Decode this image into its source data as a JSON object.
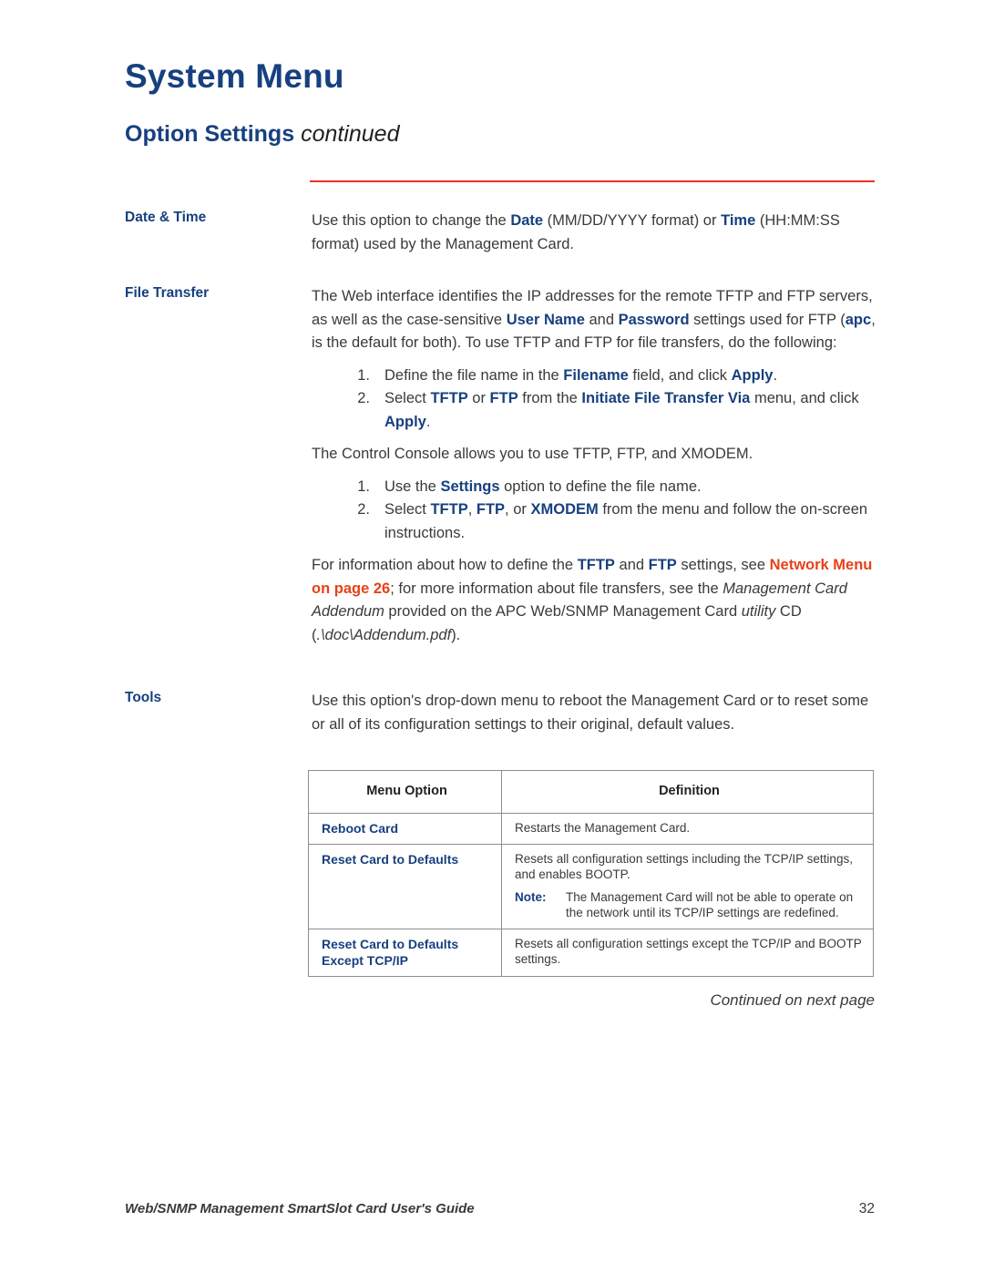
{
  "header": {
    "chapter_title": "System Menu",
    "section_title": "Option Settings",
    "section_continued": "continued"
  },
  "sections": [
    {
      "label": "Date & Time",
      "paragraphs": [
        "Use this option to change the Date (MM/DD/YYYY format) or Time (HH:MM:SS format) used by the Management Card."
      ]
    },
    {
      "label": "File Transfer",
      "intro": "The Web interface identifies the IP addresses for the remote TFTP and FTP servers, as well as the case-sensitive User Name and Password settings used for FTP (apc, is the default for both). To use TFTP and FTP for file transfers, do the following:",
      "list_web": [
        "Define the file name in the Filename field, and click Apply.",
        "Select TFTP or FTP from the Initiate File Transfer Via menu, and click Apply."
      ],
      "console_intro": "The Control Console allows you to use TFTP, FTP, and XMODEM.",
      "list_console": [
        "Use the Settings option to define the file name.",
        "Select TFTP, FTP, or XMODEM from the menu and follow the on-screen instructions."
      ],
      "outro": "For information about how to define the TFTP and FTP settings, see Network Menu on page 26; for more information about file transfers, see the Management Card Addendum provided on the APC Web/SNMP Management Card utility CD (.\\doc\\Addendum.pdf).",
      "xref": "Network Menu on page 26"
    },
    {
      "label": "Tools",
      "paragraphs": [
        "Use this option's drop-down menu to reboot the Management Card or to reset some or all of its configuration settings to their original, default values."
      ]
    }
  ],
  "tools_table": {
    "headers": [
      "Menu Option",
      "Definition"
    ],
    "rows": [
      {
        "option": "Reboot Card",
        "definition": "Restarts the Management Card."
      },
      {
        "option": "Reset Card to Defaults",
        "definition": "Resets all configuration settings including the TCP/IP settings, and enables BOOTP.",
        "note_label": "Note:",
        "note_text": "The Management Card will not be able to operate on the network until its TCP/IP settings are redefined."
      },
      {
        "option": "Reset Card to Defaults Except TCP/IP",
        "definition": "Resets all configuration settings except the TCP/IP and BOOTP settings."
      }
    ]
  },
  "continued_note": "Continued on next page",
  "footer": {
    "title": "Web/SNMP Management SmartSlot Card User's Guide",
    "page_number": "32"
  },
  "colors": {
    "heading_blue": "#17407f",
    "rule_red": "#ee3224",
    "xref_orange": "#e8411a",
    "body_gray": "#3a3a3a",
    "table_border": "#8d8d8d"
  }
}
